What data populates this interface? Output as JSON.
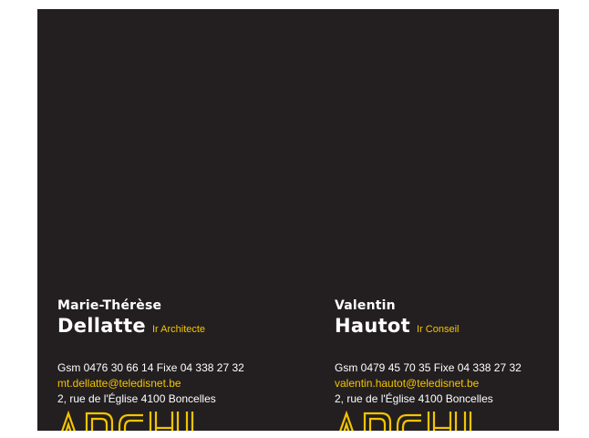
{
  "cards": [
    {
      "first_name": "Marie-Thérèse",
      "last_name": "Dellatte",
      "title": "Ir Architecte",
      "phones": "Gsm 0476 30 66 14 Fixe  04 338 27 32",
      "email": "mt.dellatte@teledisnet.be",
      "address": "2, rue de l'Église 4100 Boncelles",
      "logo_text": "ARCHI"
    },
    {
      "first_name": "Valentin",
      "last_name": "Hautot",
      "title": "Ir Conseil",
      "phones": "Gsm 0479 45 70 35 Fixe  04 338 27 32",
      "email": "valentin.hautot@teledisnet.be",
      "address": "2, rue de l'Église 4100 Boncelles",
      "logo_text": "ARCHI"
    }
  ],
  "colors": {
    "background": "#231f20",
    "accent": "#f5c400",
    "text": "#ffffff"
  }
}
